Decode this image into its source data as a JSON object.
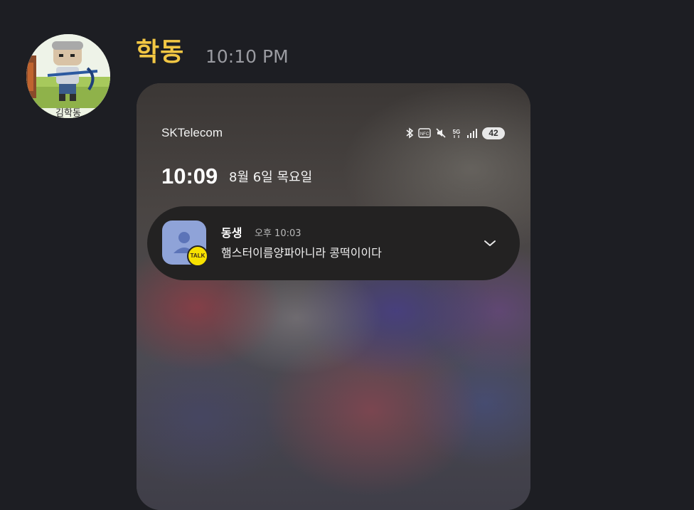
{
  "message": {
    "sender": "학동",
    "time": "10:10 PM",
    "avatar_caption": "김학동"
  },
  "screenshot": {
    "status_bar": {
      "carrier": "SKTelecom",
      "icons": [
        "bluetooth-icon",
        "nfc-icon",
        "mute-icon",
        "5g-icon",
        "signal-icon"
      ],
      "nfc_label": "NFC",
      "network_label": "5G",
      "battery": "42"
    },
    "lock_screen": {
      "time": "10:09",
      "date": "8월 6일 목요일"
    },
    "notification": {
      "app_icon": "kakaotalk-icon",
      "badge": "TALK",
      "sender": "동생",
      "time": "오후 10:03",
      "message": "햄스터이름양파아니라 콩떡이이다"
    }
  },
  "colors": {
    "background": "#1d1e23",
    "sender_name": "#f2c744",
    "time": "#9a9ba1",
    "notification_bg": "#232222",
    "kakao_yellow": "#f7e100"
  }
}
